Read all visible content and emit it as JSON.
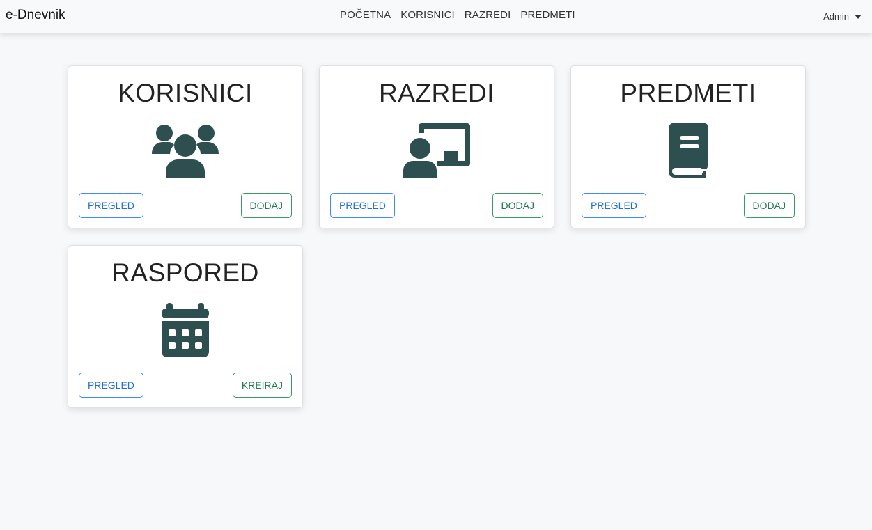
{
  "nav": {
    "brand": "e-Dnevnik",
    "links": [
      "POČETNA",
      "KORISNICI",
      "RAZREDI",
      "PREDMETI"
    ],
    "user": "Admin"
  },
  "colors": {
    "icon": "#2d4f4f",
    "primary": "#1f6fd6",
    "success": "#1f7a4d"
  },
  "cards": [
    {
      "title": "KORISNICI",
      "icon": "users-icon",
      "primary_label": "PREGLED",
      "secondary_label": "DODAJ"
    },
    {
      "title": "RAZREDI",
      "icon": "chalkboard-teacher-icon",
      "primary_label": "PREGLED",
      "secondary_label": "DODAJ"
    },
    {
      "title": "PREDMETI",
      "icon": "book-icon",
      "primary_label": "PREGLED",
      "secondary_label": "DODAJ"
    },
    {
      "title": "RASPORED",
      "icon": "calendar-icon",
      "primary_label": "PREGLED",
      "secondary_label": "KREIRAJ"
    }
  ]
}
